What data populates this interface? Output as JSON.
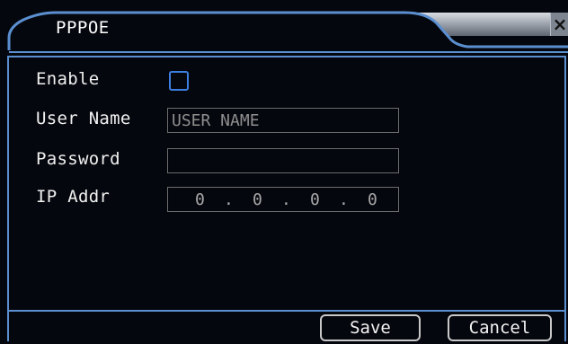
{
  "window": {
    "title": "PPPOE",
    "close_glyph": "×"
  },
  "form": {
    "enable_label": "Enable",
    "enable_checked": false,
    "username_label": "User Name",
    "username_value": "USER NAME",
    "password_label": "Password",
    "password_value": "",
    "ip_label": "IP Addr",
    "ip_octets": [
      "0",
      "0",
      "0",
      "0"
    ],
    "ip_separator": "."
  },
  "footer": {
    "save_label": "Save",
    "cancel_label": "Cancel"
  },
  "colors": {
    "accent": "#5b8fd0",
    "checkbox": "#3d7fe0",
    "background": "#05070e"
  }
}
